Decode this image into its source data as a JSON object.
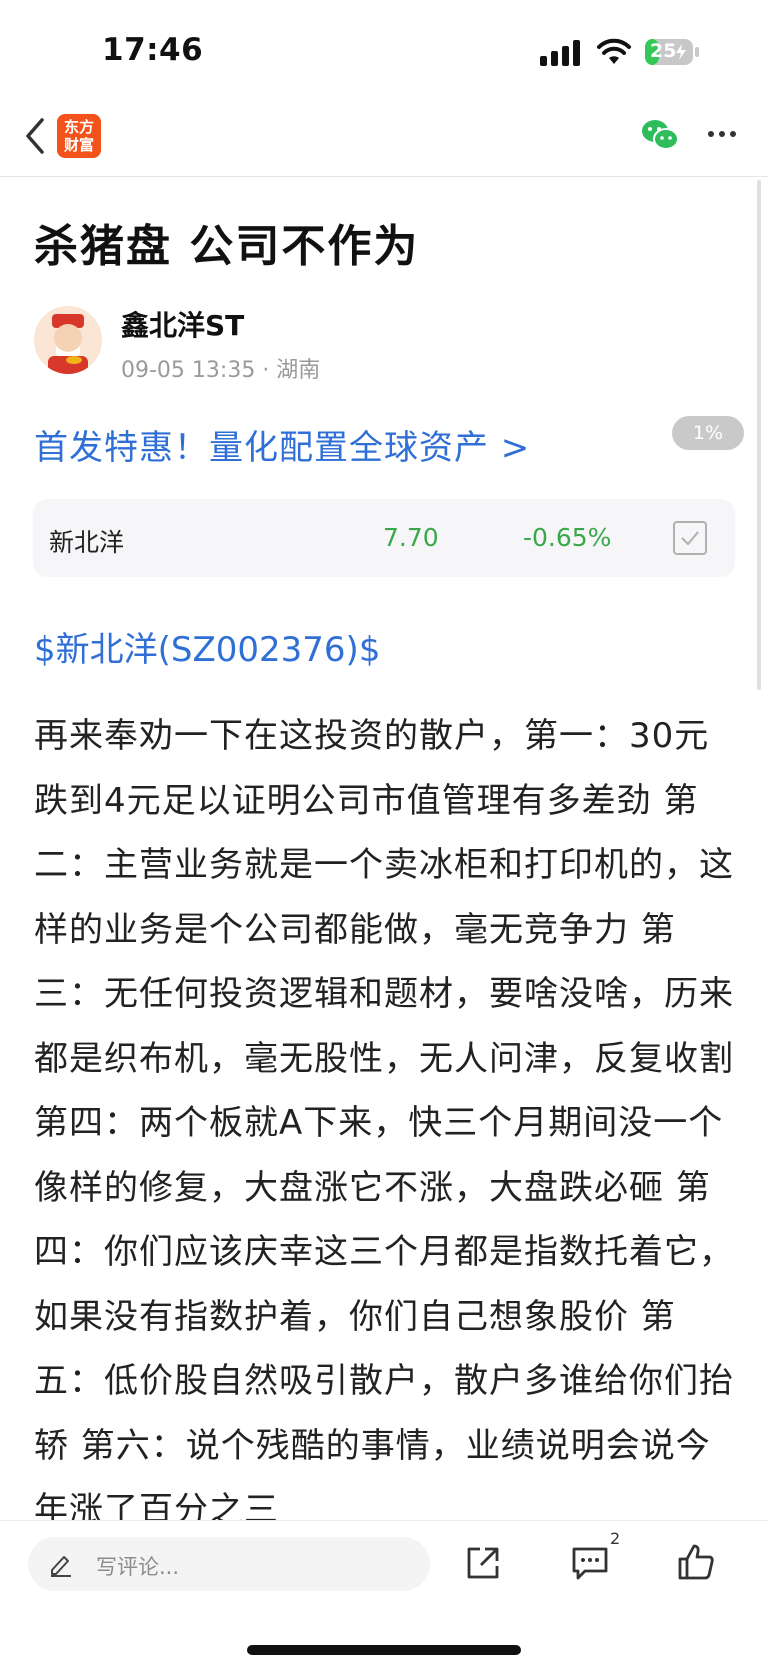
{
  "status": {
    "time": "17:46",
    "battery": "25"
  },
  "header": {
    "logo_line1": "东方",
    "logo_line2": "财富"
  },
  "post": {
    "title": "杀猪盘 公司不作为",
    "author": "鑫北洋ST",
    "meta": "09-05 13:35 · 湖南",
    "promo": "首发特惠！量化配置全球资产 >",
    "scroll_pct": "1%",
    "ticker": "$新北洋(SZ002376)$",
    "body": "再来奉劝一下在这投资的散户，第一：30元跌到4元足以证明公司市值管理有多差劲 第二：主营业务就是一个卖冰柜和打印机的，这样的业务是个公司都能做，毫无竞争力 第三：无任何投资逻辑和题材，要啥没啥，历来都是织布机，毫无股性，无人问津，反复收割 第四：两个板就A下来，快三个月期间没一个像样的修复，大盘涨它不涨，大盘跌必砸 第四：你们应该庆幸这三个月都是指数托着它，如果没有指数护着，你们自己想象股价 第五：低价股自然吸引散户，散户多谁给你们抬轿 第六：说个残酷的事情，业绩说明会说今年涨了百分之三"
  },
  "stock": {
    "name": "新北洋",
    "price": "7.70",
    "change": "-0.65%"
  },
  "bottom": {
    "comment_placeholder": "写评论...",
    "comment_count": "2"
  },
  "colors": {
    "link": "#2f6fd6",
    "down": "#3aa84a",
    "brand": "#f3521b"
  }
}
